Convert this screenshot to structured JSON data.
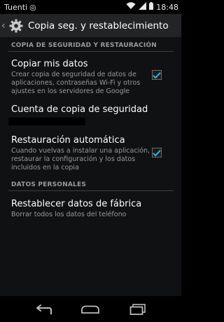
{
  "status_bar": {
    "carrier": "Tuenti",
    "time": "18:48"
  },
  "action_bar": {
    "title": "Copia seg. y restablecimiento"
  },
  "sections": {
    "backup_header": "COPIA DE SEGURIDAD Y RESTAURACIÓN",
    "personal_header": "DATOS PERSONALES"
  },
  "prefs": {
    "copy_data": {
      "title": "Copiar mis datos",
      "summary": "Crear copia de seguridad de datos de aplicaciones, contraseñas Wi-Fi y otros ajustes en los servidores de Google",
      "checked": true
    },
    "backup_account": {
      "title": "Cuenta de copia de seguridad"
    },
    "auto_restore": {
      "title": "Restauración automática",
      "summary": "Cuando vuelvas a instalar una aplicación, restaurar la configuración y los datos incluidos en la copia",
      "checked": true
    },
    "factory_reset": {
      "title": "Restablecer datos de fábrica",
      "summary": "Borrar todos los datos del teléfono"
    }
  },
  "colors": {
    "accent": "#33b5e5",
    "header_text": "#9a9a9a",
    "background": "#101112"
  },
  "icons": {
    "carrier": "carrier-icon",
    "status": [
      "wifi-icon",
      "signal-icon",
      "battery-icon"
    ],
    "nav": [
      "back-icon",
      "home-icon",
      "recents-icon"
    ]
  }
}
